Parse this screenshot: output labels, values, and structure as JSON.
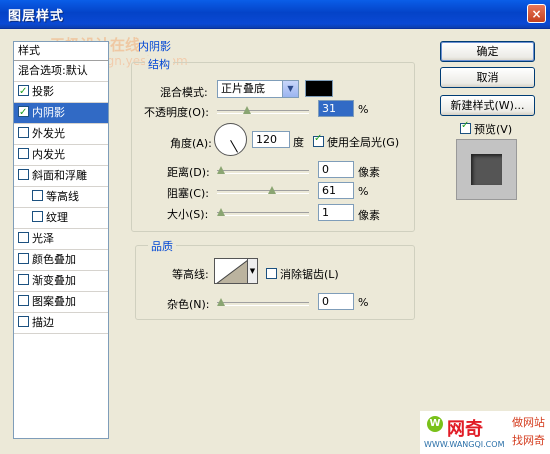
{
  "window": {
    "title": "图层样式",
    "close_label": "×"
  },
  "watermark": {
    "line1": "天极设计在线",
    "line2": "design.yesky.com"
  },
  "sidebar": {
    "header": "样式",
    "items": [
      {
        "label": "混合选项:默认",
        "checkbox": false,
        "checked": false,
        "indent": false,
        "selected": false
      },
      {
        "label": "投影",
        "checkbox": true,
        "checked": true,
        "indent": false,
        "selected": false
      },
      {
        "label": "内阴影",
        "checkbox": true,
        "checked": true,
        "indent": false,
        "selected": true
      },
      {
        "label": "外发光",
        "checkbox": true,
        "checked": false,
        "indent": false,
        "selected": false
      },
      {
        "label": "内发光",
        "checkbox": true,
        "checked": false,
        "indent": false,
        "selected": false
      },
      {
        "label": "斜面和浮雕",
        "checkbox": true,
        "checked": false,
        "indent": false,
        "selected": false
      },
      {
        "label": "等高线",
        "checkbox": true,
        "checked": false,
        "indent": true,
        "selected": false
      },
      {
        "label": "纹理",
        "checkbox": true,
        "checked": false,
        "indent": true,
        "selected": false
      },
      {
        "label": "光泽",
        "checkbox": true,
        "checked": false,
        "indent": false,
        "selected": false
      },
      {
        "label": "颜色叠加",
        "checkbox": true,
        "checked": false,
        "indent": false,
        "selected": false
      },
      {
        "label": "渐变叠加",
        "checkbox": true,
        "checked": false,
        "indent": false,
        "selected": false
      },
      {
        "label": "图案叠加",
        "checkbox": true,
        "checked": false,
        "indent": false,
        "selected": false
      },
      {
        "label": "描边",
        "checkbox": true,
        "checked": false,
        "indent": false,
        "selected": false
      }
    ]
  },
  "inner_shadow": {
    "section_title": "内阴影",
    "structure_title": "结构",
    "blend_mode_label": "混合模式:",
    "blend_mode_value": "正片叠底",
    "shadow_color": "#000000",
    "opacity_label": "不透明度(O):",
    "opacity_value": "31",
    "opacity_unit": "%",
    "opacity_level": 0.31,
    "angle_label": "角度(A):",
    "angle_value": "120",
    "angle_unit": "度",
    "global_light_label": "使用全局光(G)",
    "global_light_checked": true,
    "distance_label": "距离(D):",
    "distance_value": "0",
    "distance_unit": "像素",
    "distance_level": 0,
    "choke_label": "阻塞(C):",
    "choke_value": "61",
    "choke_unit": "%",
    "choke_level": 0.61,
    "size_label": "大小(S):",
    "size_value": "1",
    "size_unit": "像素",
    "size_level": 0.004
  },
  "quality": {
    "title": "品质",
    "contour_label": "等高线:",
    "antialias_label": "消除锯齿(L)",
    "antialias_checked": false,
    "noise_label": "杂色(N):",
    "noise_value": "0",
    "noise_unit": "%",
    "noise_level": 0
  },
  "buttons": {
    "ok": "确定",
    "cancel": "取消",
    "new_style": "新建样式(W)...",
    "preview_label": "预览(V)",
    "preview_checked": true
  },
  "logo": {
    "main": "网奇",
    "sub": "WWW.WANGQI.COM",
    "right_line1": "做网站",
    "right_line2": "找网奇",
    "badge": "W"
  }
}
